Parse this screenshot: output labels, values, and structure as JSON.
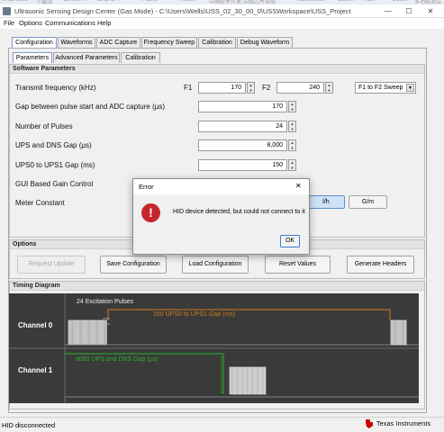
{
  "window": {
    "title": "Ultrasonic Sensing Design Center (Gas Mode) - C:\\Users\\Wells\\USS_02_30_00_0\\USSWorkspace\\USS_Project",
    "minimize_glyph": "—",
    "maximize_glyph": "☐",
    "close_glyph": "✕"
  },
  "background_tabs": [
    "ie lab build",
    "下载站",
    "Conner…",
    "Chat GPT",
    "Fluent",
    "Twitch",
    "中国软件开发…",
    "中国芯片采购",
    "MathWorks",
    "CCSN",
    "ALAT",
    "CCSN",
    "多功能测试"
  ],
  "menu": [
    "File",
    "Options",
    "Communications",
    "Help"
  ],
  "tabs": [
    "Configuration",
    "Waveforms",
    "ADC Capture",
    "Frequency Sweep",
    "Calibration",
    "Debug Waveform"
  ],
  "subtabs": [
    "Parameters",
    "Advanced Parameters",
    "Calibration"
  ],
  "software_parameters": {
    "header": "Software Parameters",
    "transmit_frequency_label": "Transmit frequency (kHz)",
    "f1_label": "F1",
    "f1_value": "170",
    "f2_label": "F2",
    "f2_value": "240",
    "sweep_mode": "F1 to F2 Sweep",
    "gap_label": "Gap between pulse start and ADC capture (µs)",
    "gap_value": "170",
    "pulses_label": "Number of Pulses",
    "pulses_value": "24",
    "ups_dns_label": "UPS and DNS Gap (µs)",
    "ups_dns_value": "8,000",
    "ups0_ups1_label": "UPS0 to UPS1 Gap (ms)",
    "ups0_ups1_value": "150",
    "gain_label": "GUI Based Gain Control",
    "meter_label": "Meter Constant",
    "unit_buttons": [
      "l/h",
      "G/m"
    ]
  },
  "options": {
    "header": "Options",
    "buttons": [
      "Request Update",
      "Save Configuration",
      "Load Configuration",
      "Reset Values",
      "Generate Headers"
    ]
  },
  "timing": {
    "header": "Timing Diagram",
    "excitation_label": "24 Excitation Pulses",
    "channel0": "Channel 0",
    "channel1": "Channel 1",
    "ups0_ups1_gap_label": "150 UPS0 to UPS1 Gap (ms)",
    "ups_dns_gap_label": "8000 UPS and DNS Gap (µs)",
    "colors": {
      "orange": "#d07c1a",
      "green": "#27b427",
      "pulse": "#e8e8e8",
      "background": "#3a3a3a"
    }
  },
  "dialog": {
    "title": "Error",
    "close_glyph": "✕",
    "message": "HID device detected, but could not connect to it",
    "ok_label": "OK",
    "icon": "error-icon"
  },
  "status": {
    "text": "HID disconnected",
    "logo_text": "Texas Instruments"
  }
}
